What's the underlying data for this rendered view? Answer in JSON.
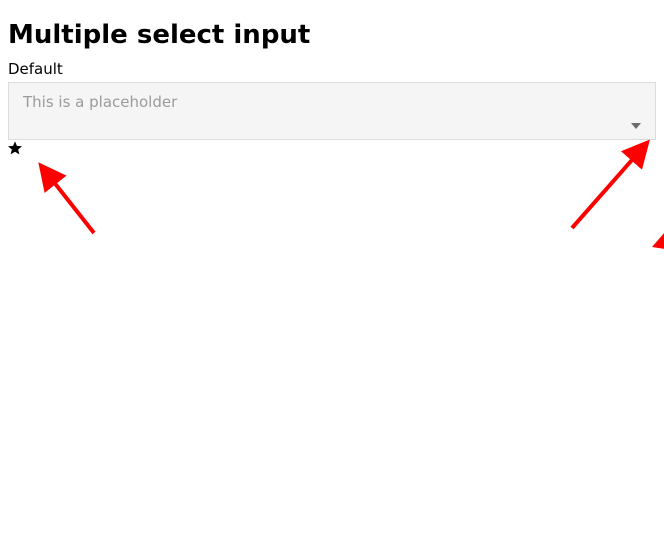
{
  "page": {
    "title": "Multiple select input"
  },
  "field": {
    "label": "Default",
    "placeholder": "This is a placeholder"
  },
  "colors": {
    "annotation_arrow": "#ff0000",
    "star": "#000000"
  }
}
